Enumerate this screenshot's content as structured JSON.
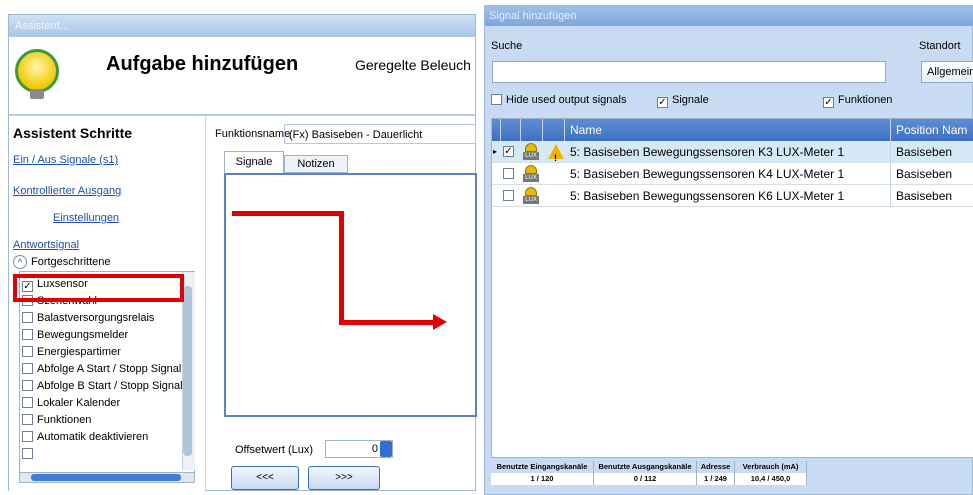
{
  "left_window": {
    "title": "Assistent...",
    "header_title": "Aufgabe hinzufügen",
    "header_subtitle": "Geregelte Beleuch",
    "steps_heading": "Assistent Schritte",
    "steps": [
      {
        "label": "Ein / Aus Signale (s1)"
      },
      {
        "label": "Kontrollierter Ausgang"
      },
      {
        "label": "Einstellungen"
      },
      {
        "label": "Antwortsignal"
      }
    ],
    "advanced_label": "Fortgeschrittene",
    "advanced_items": [
      {
        "label": "Luxsensor",
        "checked": true
      },
      {
        "label": "Szenenwahl",
        "checked": false
      },
      {
        "label": "Balastversorgungsrelais",
        "checked": false
      },
      {
        "label": "Bewegungsmelder",
        "checked": false
      },
      {
        "label": "Energiespartimer",
        "checked": false
      },
      {
        "label": "Abfolge A Start / Stopp Signal",
        "checked": false
      },
      {
        "label": "Abfolge B Start / Stopp Signal",
        "checked": false
      },
      {
        "label": "Lokaler Kalender",
        "checked": false
      },
      {
        "label": "Funktionen",
        "checked": false
      },
      {
        "label": "Automatik deaktivieren",
        "checked": false
      }
    ],
    "function_name_label": "Funktionsname",
    "function_name_value": "(Fx) Basiseben - Dauerlicht",
    "tabs": [
      {
        "label": "Signale"
      },
      {
        "label": "Notizen"
      }
    ],
    "offset_label": "Offsetwert (Lux)",
    "offset_value": "0",
    "back_button": "<<<",
    "next_button": ">>>"
  },
  "right_window": {
    "title": "Signal hinzufügen",
    "search_label": "Suche",
    "search_value": "",
    "location_label": "Standort",
    "location_value": "Allgemein",
    "options": [
      {
        "label": "Hide used output signals",
        "checked": false
      },
      {
        "label": "Signale",
        "checked": true
      },
      {
        "label": "Funktionen",
        "checked": true
      }
    ],
    "columns": {
      "name": "Name",
      "position": "Position Nam"
    },
    "rows": [
      {
        "name": "5: Basiseben Bewegungssensoren K3 LUX-Meter 1",
        "position": "Basiseben",
        "checked": true,
        "warning": true
      },
      {
        "name": "5: Basiseben Bewegungssensoren K4 LUX-Meter 1",
        "position": "Basiseben",
        "checked": false,
        "warning": false
      },
      {
        "name": "5: Basiseben Bewegungssensoren K6 LUX-Meter 1",
        "position": "Basiseben",
        "checked": false,
        "warning": false
      }
    ],
    "lux_icon_text": "LUX",
    "status": {
      "headers": [
        "Benutzte Eingangskanäle",
        "Benutzte Ausgangskanäle",
        "Adresse",
        "Verbrauch (mA)"
      ],
      "values": [
        "1 / 120",
        "0 / 112",
        "1 / 249",
        "10,4 / 450,0"
      ]
    }
  },
  "colors": {
    "highlight_red": "#e00000",
    "grid_header_blue": "#3c6fbf",
    "selected_row": "#d4e8f6"
  },
  "icons": [
    "light-bulb-icon",
    "chevron-up-icon",
    "warning-icon",
    "lux-sensor-icon",
    "spin-icon"
  ]
}
